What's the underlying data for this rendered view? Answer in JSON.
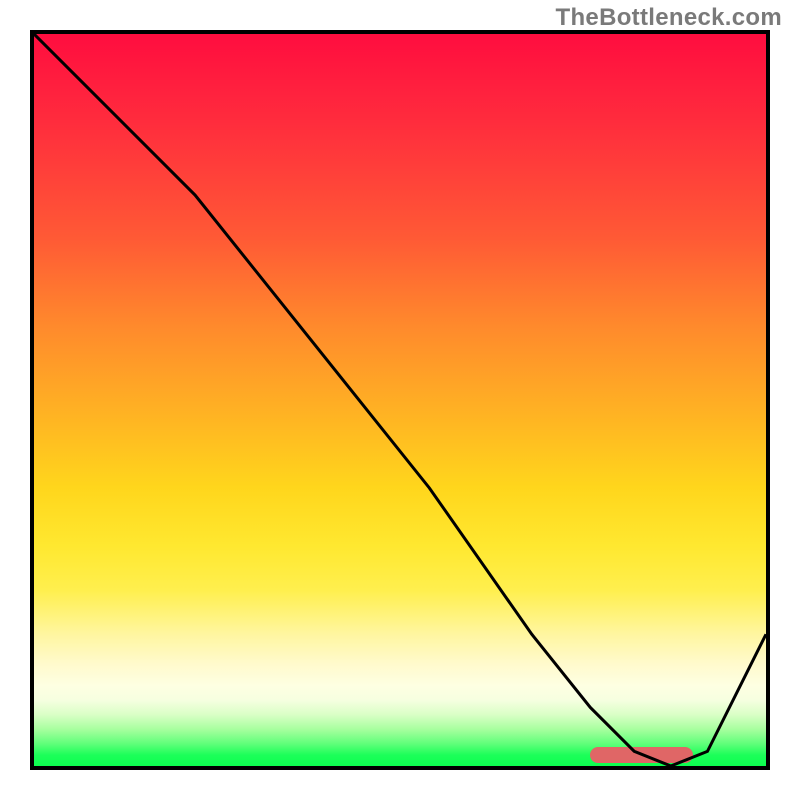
{
  "watermark": "TheBottleneck.com",
  "colors": {
    "border": "#000000",
    "curve": "#000000",
    "target_bar": "#e06666"
  },
  "chart_data": {
    "type": "line",
    "title": "",
    "xlabel": "",
    "ylabel": "",
    "xlim": [
      0,
      100
    ],
    "ylim": [
      0,
      100
    ],
    "grid": false,
    "legend": false,
    "note": "Axes have no visible ticks or labels. Values are read as percentage of plot width (x) and plot height (y, 0 = bottom, 100 = top).",
    "series": [
      {
        "name": "bottleneck-curve",
        "x": [
          0,
          10,
          22,
          38,
          54,
          68,
          76,
          82,
          87,
          92,
          100
        ],
        "y": [
          100,
          90,
          78,
          58,
          38,
          18,
          8,
          2,
          0,
          2,
          18
        ]
      }
    ],
    "target_zone": {
      "note": "Horizontal rounded bar marking sweet-spot near bottom",
      "x_start": 76,
      "x_end": 90,
      "y": 1.5,
      "thickness_pct": 2.2
    },
    "gradient_stops": [
      {
        "pct": 0,
        "color": "#ff0d3f"
      },
      {
        "pct": 28,
        "color": "#ff5a35"
      },
      {
        "pct": 52,
        "color": "#ffb323"
      },
      {
        "pct": 70,
        "color": "#ffe830"
      },
      {
        "pct": 89,
        "color": "#feffe2"
      },
      {
        "pct": 97,
        "color": "#5eff79"
      },
      {
        "pct": 100,
        "color": "#0cff4f"
      }
    ]
  }
}
